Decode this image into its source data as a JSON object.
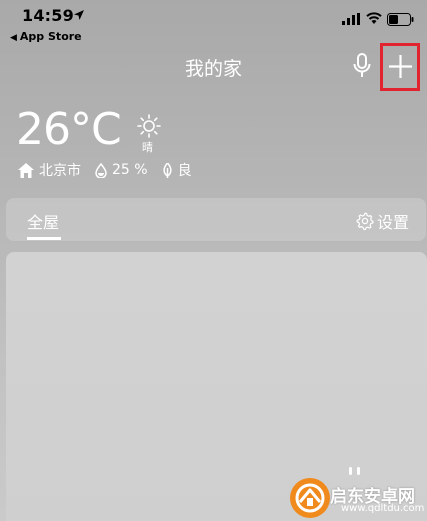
{
  "status_bar": {
    "time": "14:59",
    "back_app": "App Store"
  },
  "header": {
    "title": "我的家",
    "mic_icon": "microphone-icon",
    "add_icon": "plus-icon"
  },
  "weather": {
    "temperature": "26°C",
    "condition": "晴",
    "city": "北京市",
    "humidity": "25 %",
    "air_quality": "良"
  },
  "tabs": {
    "all_label": "全屋",
    "settings_label": "设置"
  },
  "watermark": {
    "name": "启东安卓网",
    "url": "www.qdltdu.com"
  },
  "colors": {
    "highlight_box": "#e0232e",
    "watermark_orange": "#f08a1c"
  }
}
